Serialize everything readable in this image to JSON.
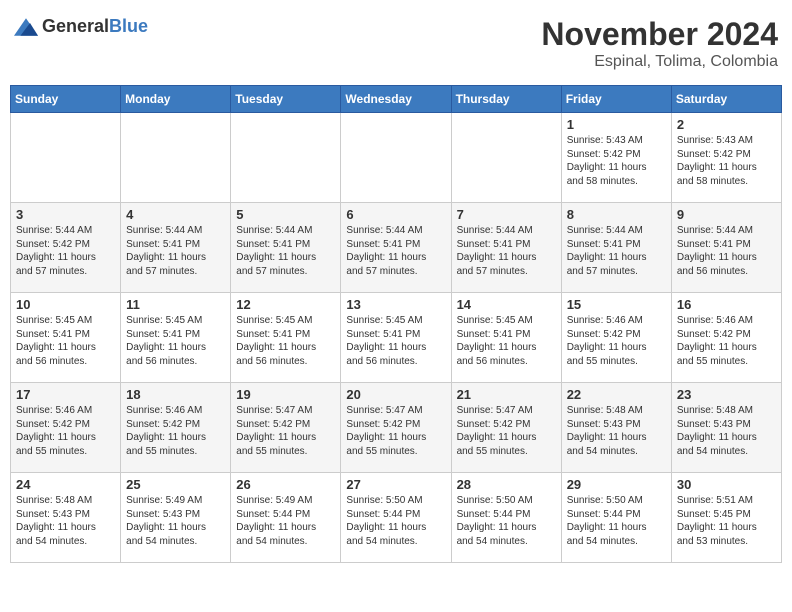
{
  "header": {
    "logo_general": "General",
    "logo_blue": "Blue",
    "month_title": "November 2024",
    "location": "Espinal, Tolima, Colombia"
  },
  "weekdays": [
    "Sunday",
    "Monday",
    "Tuesday",
    "Wednesday",
    "Thursday",
    "Friday",
    "Saturday"
  ],
  "weeks": [
    [
      {
        "day": "",
        "info": ""
      },
      {
        "day": "",
        "info": ""
      },
      {
        "day": "",
        "info": ""
      },
      {
        "day": "",
        "info": ""
      },
      {
        "day": "",
        "info": ""
      },
      {
        "day": "1",
        "info": "Sunrise: 5:43 AM\nSunset: 5:42 PM\nDaylight: 11 hours and 58 minutes."
      },
      {
        "day": "2",
        "info": "Sunrise: 5:43 AM\nSunset: 5:42 PM\nDaylight: 11 hours and 58 minutes."
      }
    ],
    [
      {
        "day": "3",
        "info": "Sunrise: 5:44 AM\nSunset: 5:42 PM\nDaylight: 11 hours and 57 minutes."
      },
      {
        "day": "4",
        "info": "Sunrise: 5:44 AM\nSunset: 5:41 PM\nDaylight: 11 hours and 57 minutes."
      },
      {
        "day": "5",
        "info": "Sunrise: 5:44 AM\nSunset: 5:41 PM\nDaylight: 11 hours and 57 minutes."
      },
      {
        "day": "6",
        "info": "Sunrise: 5:44 AM\nSunset: 5:41 PM\nDaylight: 11 hours and 57 minutes."
      },
      {
        "day": "7",
        "info": "Sunrise: 5:44 AM\nSunset: 5:41 PM\nDaylight: 11 hours and 57 minutes."
      },
      {
        "day": "8",
        "info": "Sunrise: 5:44 AM\nSunset: 5:41 PM\nDaylight: 11 hours and 57 minutes."
      },
      {
        "day": "9",
        "info": "Sunrise: 5:44 AM\nSunset: 5:41 PM\nDaylight: 11 hours and 56 minutes."
      }
    ],
    [
      {
        "day": "10",
        "info": "Sunrise: 5:45 AM\nSunset: 5:41 PM\nDaylight: 11 hours and 56 minutes."
      },
      {
        "day": "11",
        "info": "Sunrise: 5:45 AM\nSunset: 5:41 PM\nDaylight: 11 hours and 56 minutes."
      },
      {
        "day": "12",
        "info": "Sunrise: 5:45 AM\nSunset: 5:41 PM\nDaylight: 11 hours and 56 minutes."
      },
      {
        "day": "13",
        "info": "Sunrise: 5:45 AM\nSunset: 5:41 PM\nDaylight: 11 hours and 56 minutes."
      },
      {
        "day": "14",
        "info": "Sunrise: 5:45 AM\nSunset: 5:41 PM\nDaylight: 11 hours and 56 minutes."
      },
      {
        "day": "15",
        "info": "Sunrise: 5:46 AM\nSunset: 5:42 PM\nDaylight: 11 hours and 55 minutes."
      },
      {
        "day": "16",
        "info": "Sunrise: 5:46 AM\nSunset: 5:42 PM\nDaylight: 11 hours and 55 minutes."
      }
    ],
    [
      {
        "day": "17",
        "info": "Sunrise: 5:46 AM\nSunset: 5:42 PM\nDaylight: 11 hours and 55 minutes."
      },
      {
        "day": "18",
        "info": "Sunrise: 5:46 AM\nSunset: 5:42 PM\nDaylight: 11 hours and 55 minutes."
      },
      {
        "day": "19",
        "info": "Sunrise: 5:47 AM\nSunset: 5:42 PM\nDaylight: 11 hours and 55 minutes."
      },
      {
        "day": "20",
        "info": "Sunrise: 5:47 AM\nSunset: 5:42 PM\nDaylight: 11 hours and 55 minutes."
      },
      {
        "day": "21",
        "info": "Sunrise: 5:47 AM\nSunset: 5:42 PM\nDaylight: 11 hours and 55 minutes."
      },
      {
        "day": "22",
        "info": "Sunrise: 5:48 AM\nSunset: 5:43 PM\nDaylight: 11 hours and 54 minutes."
      },
      {
        "day": "23",
        "info": "Sunrise: 5:48 AM\nSunset: 5:43 PM\nDaylight: 11 hours and 54 minutes."
      }
    ],
    [
      {
        "day": "24",
        "info": "Sunrise: 5:48 AM\nSunset: 5:43 PM\nDaylight: 11 hours and 54 minutes."
      },
      {
        "day": "25",
        "info": "Sunrise: 5:49 AM\nSunset: 5:43 PM\nDaylight: 11 hours and 54 minutes."
      },
      {
        "day": "26",
        "info": "Sunrise: 5:49 AM\nSunset: 5:44 PM\nDaylight: 11 hours and 54 minutes."
      },
      {
        "day": "27",
        "info": "Sunrise: 5:50 AM\nSunset: 5:44 PM\nDaylight: 11 hours and 54 minutes."
      },
      {
        "day": "28",
        "info": "Sunrise: 5:50 AM\nSunset: 5:44 PM\nDaylight: 11 hours and 54 minutes."
      },
      {
        "day": "29",
        "info": "Sunrise: 5:50 AM\nSunset: 5:44 PM\nDaylight: 11 hours and 54 minutes."
      },
      {
        "day": "30",
        "info": "Sunrise: 5:51 AM\nSunset: 5:45 PM\nDaylight: 11 hours and 53 minutes."
      }
    ]
  ]
}
